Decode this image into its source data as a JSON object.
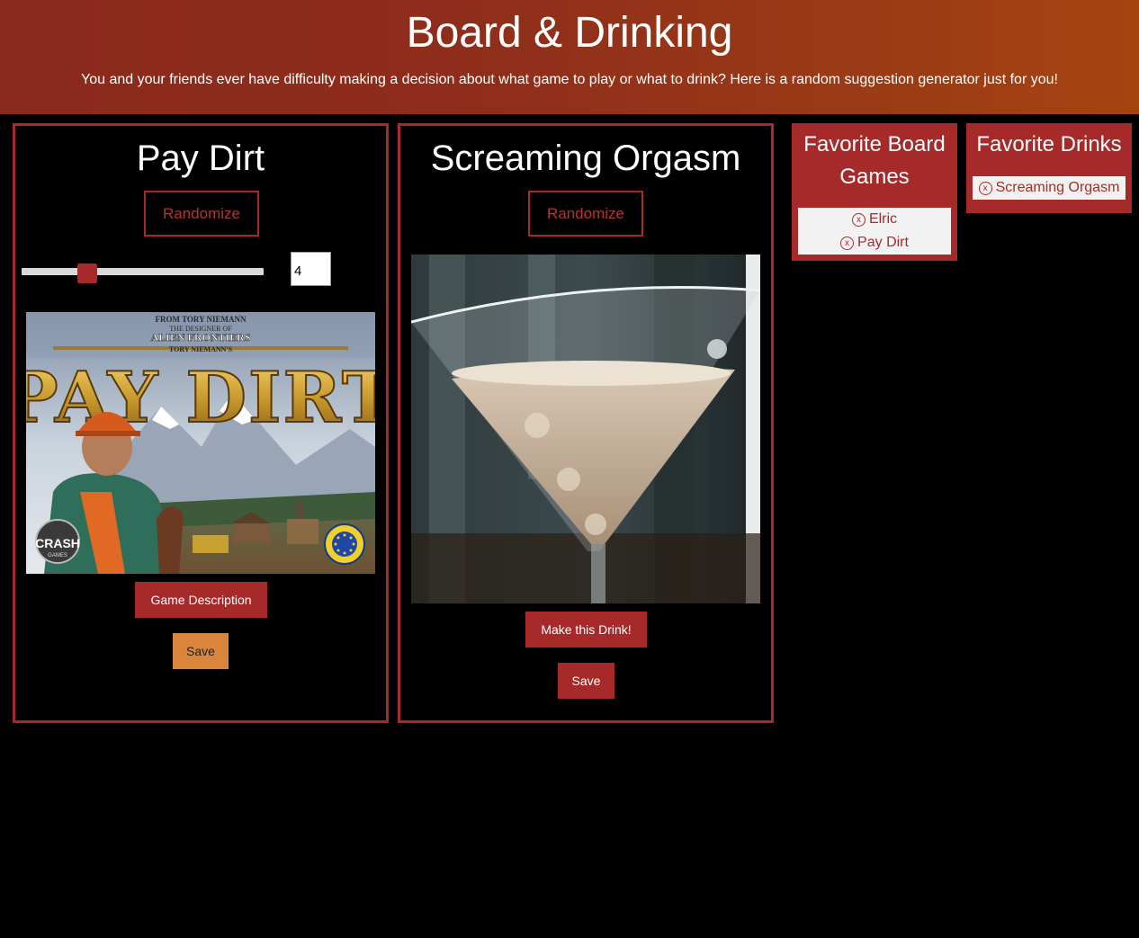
{
  "header": {
    "title": "Board & Drinking",
    "subtitle": "You and your friends ever have difficulty making a decision about what game to play or what to drink? Here is a random suggestion generator just for you!"
  },
  "game_panel": {
    "title": "Pay Dirt",
    "randomize_label": "Randomize",
    "player_count": "4",
    "slider_level_fraction": 0.27,
    "image_text": {
      "top_line": "FROM TORY NIEMANN",
      "designer_line": "THE DESIGNER OF",
      "prior_game": "ALIEN FRONTIERS",
      "author": "TORY NIEMANN'S",
      "game_title": "PAY DIRT",
      "publisher": "CRASH",
      "publisher_sub": "GAMES"
    },
    "description_label": "Game Description",
    "save_label": "Save"
  },
  "drink_panel": {
    "title": "Screaming Orgasm",
    "randomize_label": "Randomize",
    "make_label": "Make this Drink!",
    "save_label": "Save"
  },
  "favorite_games": {
    "title_line1": "Favorite Board",
    "title_line2": "Games",
    "items": [
      "Elric",
      "Pay Dirt"
    ],
    "remove_glyph": "x"
  },
  "favorite_drinks": {
    "title": "Favorite Drinks",
    "items": [
      "Screaming Orgasm"
    ],
    "remove_glyph": "x"
  },
  "colors": {
    "accent": "#a72a2a",
    "save_game_button": "#d9853b",
    "background": "#000000",
    "header_gradient_start": "#8a2a1c",
    "header_gradient_end": "#a5440f"
  }
}
